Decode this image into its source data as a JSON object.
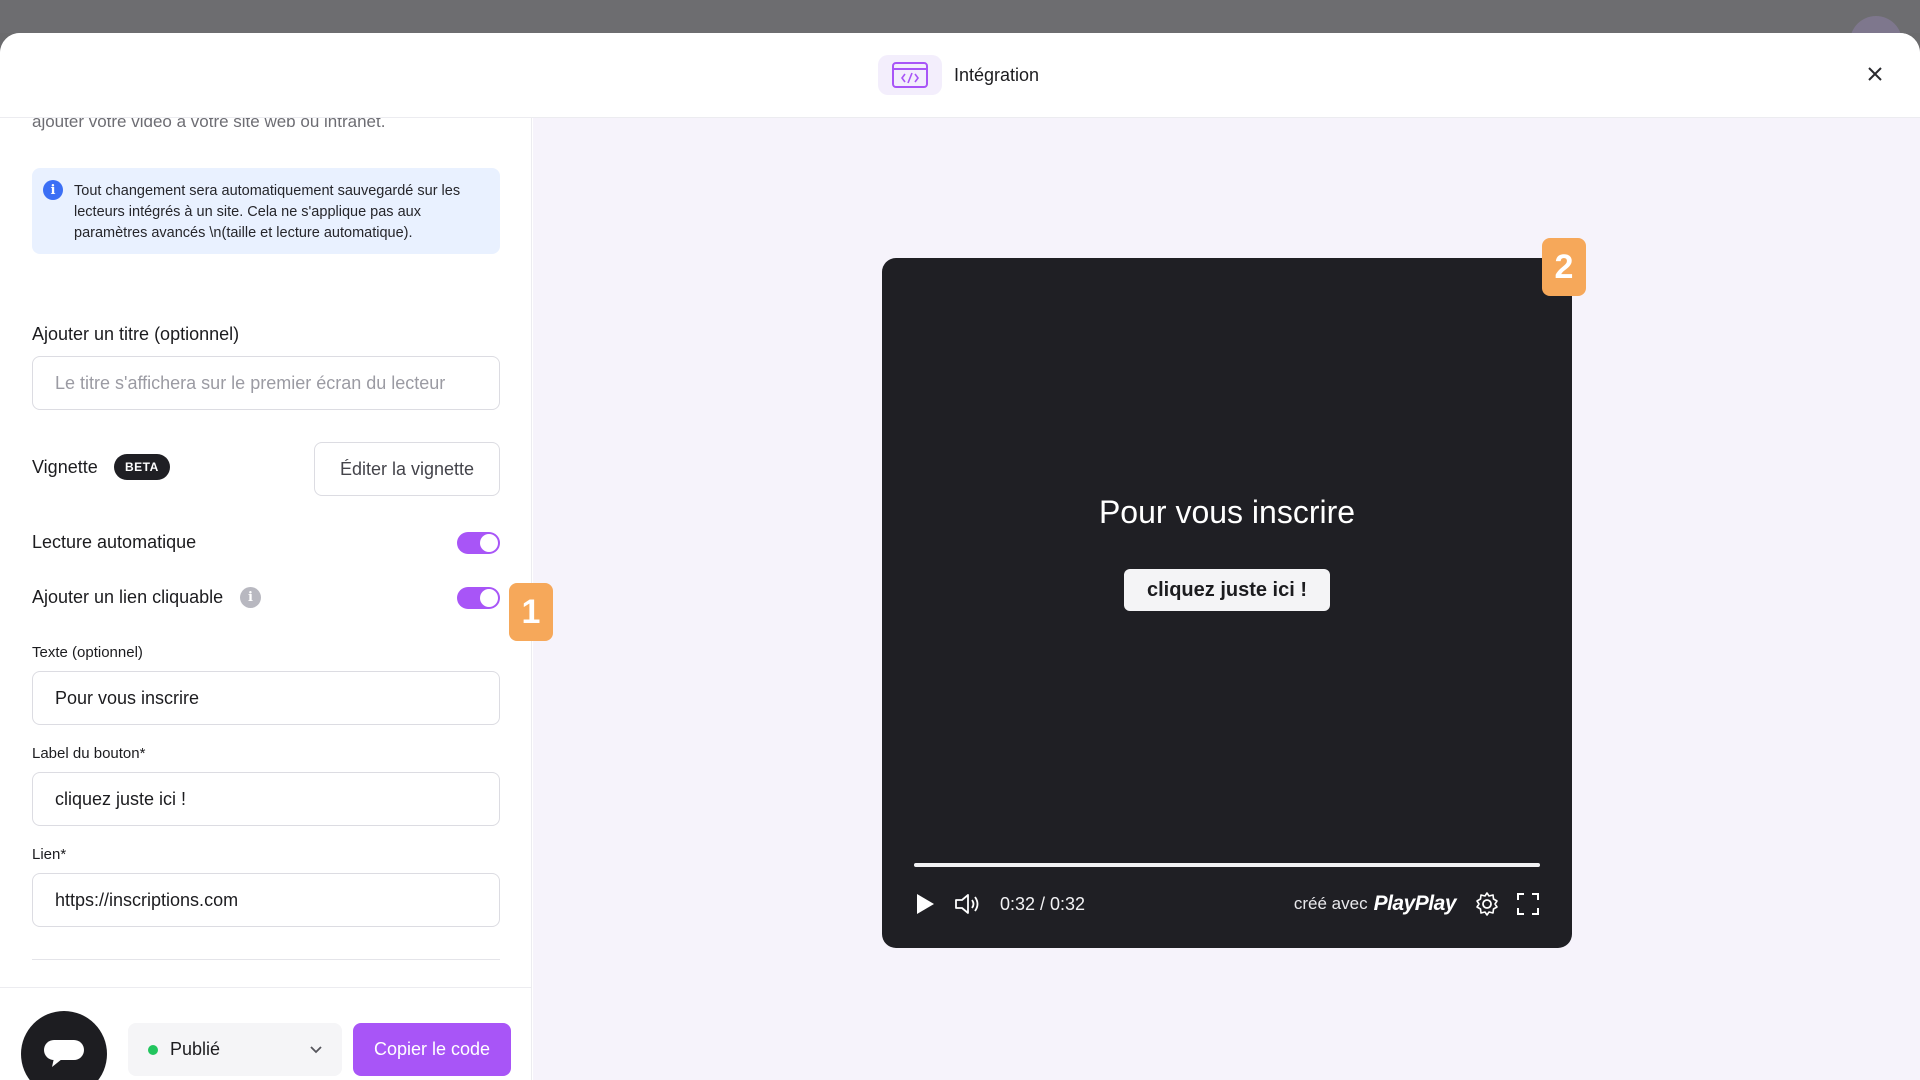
{
  "modal": {
    "title": "Intégration",
    "header_icon": "embed-code-icon",
    "close_icon": "close-icon"
  },
  "settings": {
    "intro_text": "ajouter votre vidéo à votre site web ou intranet.",
    "info_text": "Tout changement sera automatiquement sauvegardé sur les lecteurs intégrés à un site. Cela ne s'applique pas aux paramètres avancés \\n(taille et lecture automatique).",
    "title_label": "Ajouter un titre (optionnel)",
    "title_placeholder": "Le titre s'affichera sur le premier écran du lecteur",
    "title_value": "",
    "thumbnail_label": "Vignette",
    "thumbnail_badge": "BETA",
    "edit_thumbnail_label": "Éditer la vignette",
    "autoplay_label": "Lecture automatique",
    "autoplay_on": true,
    "link_label": "Ajouter un lien cliquable",
    "link_on": true,
    "text_label": "Texte (optionnel)",
    "text_value": "Pour vous inscrire",
    "button_label_label": "Label du bouton*",
    "button_label_value": "cliquez juste ici !",
    "url_label": "Lien*",
    "url_value": "https://inscriptions.com"
  },
  "footer": {
    "status": "Publié",
    "status_color": "#22c55e",
    "copy_label": "Copier le code",
    "accent": "#a855f7"
  },
  "player": {
    "overlay_text": "Pour vous inscrire",
    "overlay_button": "cliquez juste ici !",
    "time": "0:32 / 0:32",
    "progress": 1.0,
    "made_with": "créé avec",
    "brand": "PlayPlay"
  },
  "callouts": {
    "one": "1",
    "two": "2",
    "color": "#f6a85a"
  }
}
